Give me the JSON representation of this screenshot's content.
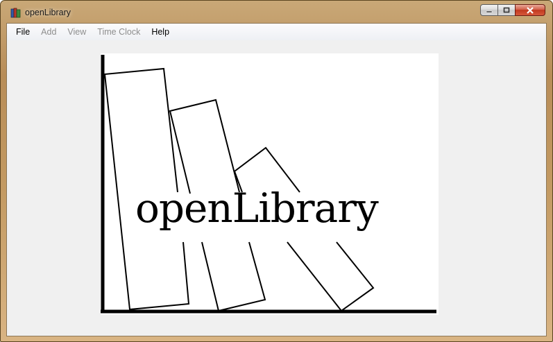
{
  "window": {
    "title": "openLibrary",
    "icon": "books-icon",
    "controls": [
      "minimize-icon",
      "maximize-icon",
      "close-icon"
    ]
  },
  "menu": {
    "file": "File",
    "add": "Add",
    "view": "View",
    "time_clock": "Time Clock",
    "help": "Help"
  },
  "logo": {
    "text": "openLibrary"
  }
}
